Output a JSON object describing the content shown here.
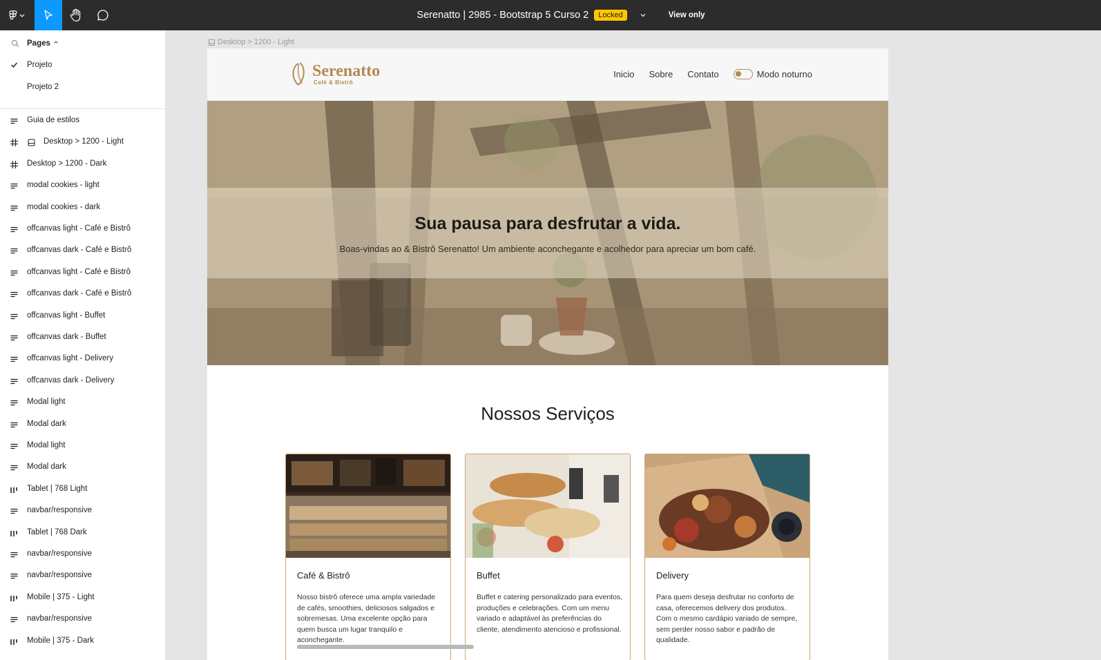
{
  "topbar": {
    "title": "Serenatto | 2985 - Bootstrap 5 Curso 2",
    "badge": "Locked",
    "view_mode": "View only",
    "accent": "#0d99ff",
    "badge_color": "#ffc700"
  },
  "pages": {
    "header": "Pages",
    "items": [
      {
        "label": "Projeto",
        "selected": true
      },
      {
        "label": "Projeto 2",
        "selected": false
      }
    ]
  },
  "layers": [
    {
      "icon": "text-lines-icon",
      "label": "Guia de estilos"
    },
    {
      "icon": "frame-hash-icon",
      "sub_icon": "component-frame-icon",
      "label": "Desktop > 1200 - Light"
    },
    {
      "icon": "frame-hash-icon",
      "label": "Desktop > 1200 - Dark"
    },
    {
      "icon": "text-lines-icon",
      "label": "modal cookies - light"
    },
    {
      "icon": "text-lines-icon",
      "label": "modal cookies - dark"
    },
    {
      "icon": "text-lines-icon",
      "label": "offcanvas light - Café e Bistrô"
    },
    {
      "icon": "text-lines-icon",
      "label": "offcanvas dark - Café e Bistrô"
    },
    {
      "icon": "text-lines-icon",
      "label": "offcanvas light - Café e Bistrô"
    },
    {
      "icon": "text-lines-icon",
      "label": "offcanvas dark - Café e Bistrô"
    },
    {
      "icon": "text-lines-icon",
      "label": "offcanvas light - Buffet"
    },
    {
      "icon": "text-lines-icon",
      "label": "offcanvas dark - Buffet"
    },
    {
      "icon": "text-lines-icon",
      "label": "offcanvas light - Delivery"
    },
    {
      "icon": "text-lines-icon",
      "label": "offcanvas dark - Delivery"
    },
    {
      "icon": "text-lines-icon",
      "label": "Modal light"
    },
    {
      "icon": "text-lines-icon",
      "label": "Modal dark"
    },
    {
      "icon": "text-lines-icon",
      "label": "Modal light"
    },
    {
      "icon": "text-lines-icon",
      "label": "Modal dark"
    },
    {
      "icon": "column-layout-icon",
      "label": "Tablet | 768 Light"
    },
    {
      "icon": "text-lines-icon",
      "label": "navbar/responsive"
    },
    {
      "icon": "column-layout-icon",
      "label": "Tablet | 768 Dark"
    },
    {
      "icon": "text-lines-icon",
      "label": "navbar/responsive"
    },
    {
      "icon": "text-lines-icon",
      "label": "navbar/responsive"
    },
    {
      "icon": "column-layout-icon",
      "label": "Mobile | 375 - Light"
    },
    {
      "icon": "text-lines-icon",
      "label": "navbar/responsive"
    },
    {
      "icon": "column-layout-icon",
      "label": "Mobile | 375 - Dark"
    }
  ],
  "canvas": {
    "frame_label": "Desktop > 1200 - Light"
  },
  "site": {
    "brand": "Serenatto",
    "brand_sub": "Café & Bistrô",
    "brand_color": "#b08a52",
    "nav": [
      "Inicio",
      "Sobre",
      "Contato"
    ],
    "night_mode_label": "Modo noturno",
    "hero_title": "Sua pausa para desfrutar a vida.",
    "hero_subtitle": "Boas-vindas ao & Bistrô Serenatto! Um ambiente aconchegante e acolhedor para apreciar um bom café.",
    "services_title": "Nossos Serviços",
    "cards": [
      {
        "title": "Café & Bistrô",
        "text": "Nosso bistrô oferece uma ampla variedade de cafés, smoothies, deliciosos salgados e sobremesas. Uma excelente opção para quem busca um lugar tranquilo e aconchegante."
      },
      {
        "title": "Buffet",
        "text": "Buffet e catering personalizado para eventos, produções e celebrações. Com um menu variado e adaptável às preferências do cliente, atendimento atencioso e profissional."
      },
      {
        "title": "Delivery",
        "text": "Para quem deseja desfrutar no conforto de casa, oferecemos delivery dos produtos. Com o mesmo cardápio variado de sempre, sem perder nosso sabor e padrão de qualidade."
      }
    ]
  }
}
